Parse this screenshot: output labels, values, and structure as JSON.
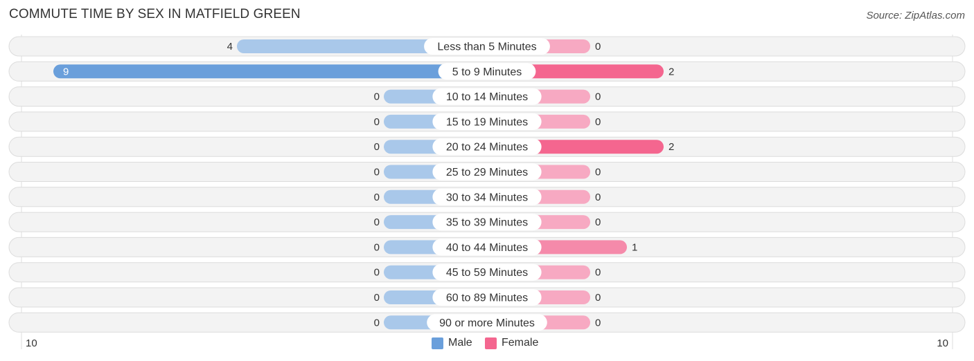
{
  "title": "COMMUTE TIME BY SEX IN MATFIELD GREEN",
  "source": "Source: ZipAtlas.com",
  "colors": {
    "male": "#6a9fdb",
    "male_light": "#a9c8ea",
    "female": "#f4668f",
    "female_light": "#f7a9c2",
    "female_mid": "#f58aaa",
    "row_bg": "#f3f3f3"
  },
  "chart_data": {
    "type": "bar",
    "orientation": "horizontal-diverging",
    "title": "COMMUTE TIME BY SEX IN MATFIELD GREEN",
    "categories": [
      "Less than 5 Minutes",
      "5 to 9 Minutes",
      "10 to 14 Minutes",
      "15 to 19 Minutes",
      "20 to 24 Minutes",
      "25 to 29 Minutes",
      "30 to 34 Minutes",
      "35 to 39 Minutes",
      "40 to 44 Minutes",
      "45 to 59 Minutes",
      "60 to 89 Minutes",
      "90 or more Minutes"
    ],
    "series": [
      {
        "name": "Male",
        "values": [
          4,
          9,
          0,
          0,
          0,
          0,
          0,
          0,
          0,
          0,
          0,
          0
        ]
      },
      {
        "name": "Female",
        "values": [
          0,
          2,
          0,
          0,
          2,
          0,
          0,
          0,
          1,
          0,
          0,
          0
        ]
      }
    ],
    "axis": {
      "left_label": "10",
      "right_label": "10",
      "max": 10
    },
    "legend": {
      "position": "bottom-center",
      "entries": [
        "Male",
        "Female"
      ]
    }
  }
}
